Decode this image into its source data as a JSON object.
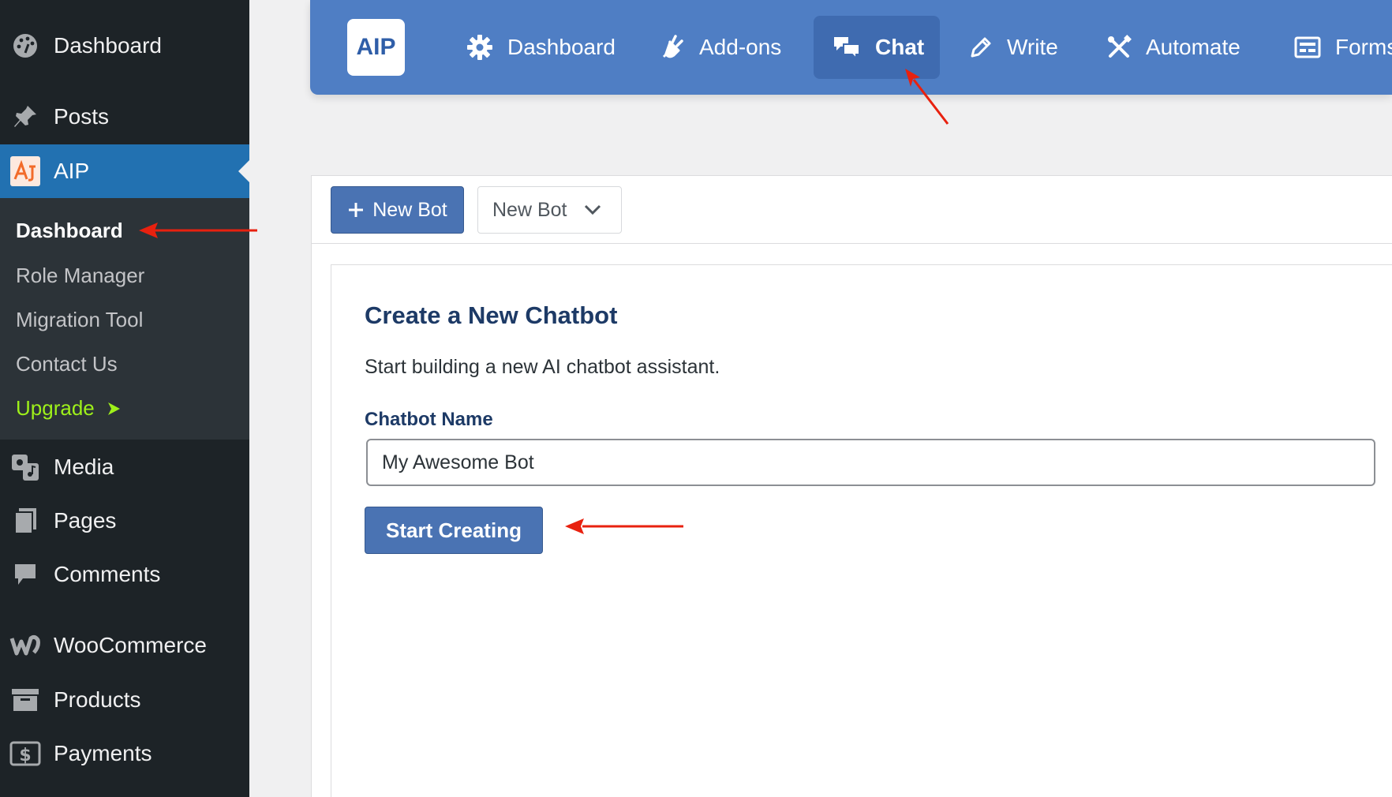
{
  "sidebar": {
    "items": [
      {
        "label": "Dashboard",
        "icon": "palette-dashboard-icon"
      },
      {
        "label": "Posts",
        "icon": "pin-icon"
      },
      {
        "label": "AIP",
        "icon": "aip-plugin-icon",
        "active": true
      },
      {
        "label": "Media",
        "icon": "media-icon"
      },
      {
        "label": "Pages",
        "icon": "pages-icon"
      },
      {
        "label": "Comments",
        "icon": "comment-icon"
      },
      {
        "label": "WooCommerce",
        "icon": "woocommerce-icon"
      },
      {
        "label": "Products",
        "icon": "archive-box-icon"
      },
      {
        "label": "Payments",
        "icon": "dollar-icon"
      }
    ],
    "submenu": [
      {
        "label": "Dashboard",
        "current": true
      },
      {
        "label": "Role Manager"
      },
      {
        "label": "Migration Tool"
      },
      {
        "label": "Contact Us"
      },
      {
        "label": "Upgrade",
        "icon": "arrow-right-icon"
      }
    ]
  },
  "topnav": {
    "logo": "AIP",
    "tabs": [
      {
        "label": "Dashboard",
        "icon": "gear-icon"
      },
      {
        "label": "Add-ons",
        "icon": "plug-icon"
      },
      {
        "label": "Chat",
        "icon": "chat-bubbles-icon",
        "active": true
      },
      {
        "label": "Write",
        "icon": "pencil-icon"
      },
      {
        "label": "Automate",
        "icon": "tools-icon"
      },
      {
        "label": "Forms",
        "icon": "form-icon"
      }
    ]
  },
  "toolbar": {
    "new_bot_label": "New Bot",
    "bot_select_value": "New Bot"
  },
  "card": {
    "title": "Create a New Chatbot",
    "description": "Start building a new AI chatbot assistant.",
    "field_label": "Chatbot Name",
    "field_value": "My Awesome Bot",
    "submit_label": "Start Creating"
  },
  "colors": {
    "sidebar_bg": "#1d2327",
    "submenu_bg": "#2c3338",
    "wp_blue": "#2271b1",
    "topnav_bg": "#4f7ec4",
    "button_bg": "#4a73b3",
    "upgrade_green": "#9ef01a",
    "annotation_red": "#e8210f"
  }
}
